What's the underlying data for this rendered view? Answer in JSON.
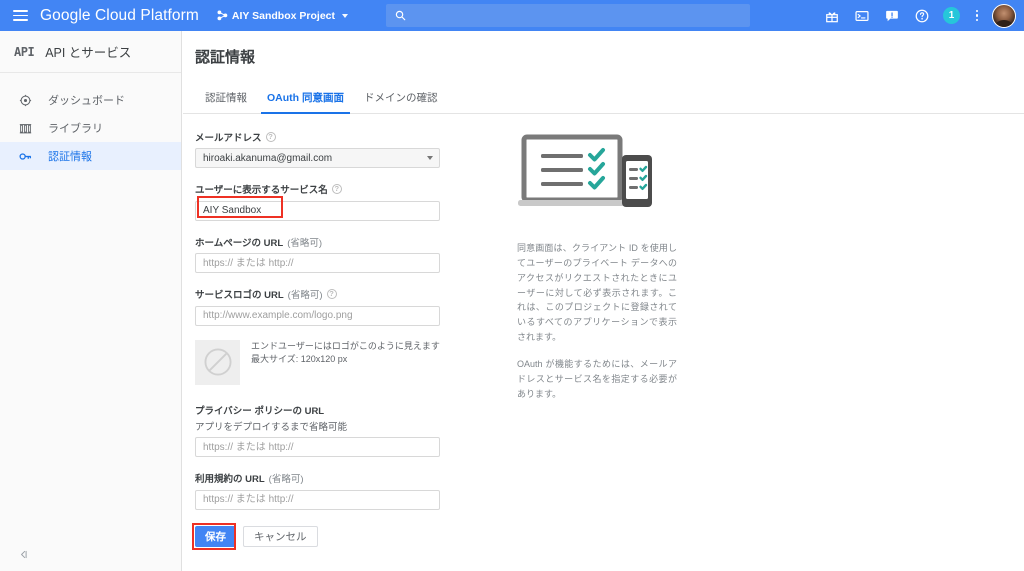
{
  "topbar": {
    "menu_icon": "hamburger-icon",
    "brand": "Google Cloud Platform",
    "project_name": "AIY Sandbox Project",
    "search_placeholder": "",
    "search_value": "",
    "icons": [
      "gift-icon",
      "cloud-shell-icon",
      "feedback-icon",
      "help-icon"
    ],
    "notification_count": "1"
  },
  "sidebar": {
    "api_mark": "API",
    "title": "API とサービス",
    "items": [
      {
        "label": "ダッシュボード",
        "icon": "dashboard-icon",
        "active": false
      },
      {
        "label": "ライブラリ",
        "icon": "library-icon",
        "active": false
      },
      {
        "label": "認証情報",
        "icon": "key-icon",
        "active": true
      }
    ],
    "collapse_label": "◁|"
  },
  "page": {
    "title": "認証情報",
    "tabs": [
      {
        "label": "認証情報",
        "active": false
      },
      {
        "label": "OAuth 同意画面",
        "active": true
      },
      {
        "label": "ドメインの確認",
        "active": false
      }
    ]
  },
  "form": {
    "email": {
      "label": "メールアドレス",
      "value": "hiroaki.akanuma@gmail.com"
    },
    "service_name": {
      "label": "ユーザーに表示するサービス名",
      "value": "AIY Sandbox",
      "placeholder": ""
    },
    "homepage_url": {
      "label": "ホームページの URL",
      "optional": "(省略可)",
      "value": "",
      "placeholder": "https:// または http://"
    },
    "logo_url": {
      "label": "サービスロゴの URL",
      "optional": "(省略可)",
      "value": "",
      "placeholder": "http://www.example.com/logo.png"
    },
    "logo_preview": {
      "note_1": "エンドユーザーにはロゴがこのように見えます",
      "note_2": "最大サイズ: 120x120 px",
      "icon": "no-image-icon"
    },
    "privacy_url": {
      "label": "プライバシー ポリシーの URL",
      "sub": "アプリをデプロイするまで省略可能",
      "value": "",
      "placeholder": "https:// または http://"
    },
    "terms_url": {
      "label": "利用規約の URL",
      "optional": "(省略可)",
      "value": "",
      "placeholder": "https:// または http://"
    },
    "save_label": "保存",
    "cancel_label": "キャンセル"
  },
  "info": {
    "illustration": "laptop-phone-checklist-illustration",
    "paragraph_1": "同意画面は、クライアント ID を使用してユーザーのプライベート データへのアクセスがリクエストされたときにユーザーに対して必ず表示されます。これは、このプロジェクトに登録されているすべてのアプリケーションで表示されます。",
    "paragraph_2": "OAuth が機能するためには、メールアドレスとサービス名を指定する必要があります。"
  },
  "colors": {
    "header_blue": "#4285f4",
    "accent_blue": "#1a73e8",
    "annotation_red": "#ee3124",
    "badge_cyan": "#26c6da",
    "check_teal": "#26a69a"
  }
}
